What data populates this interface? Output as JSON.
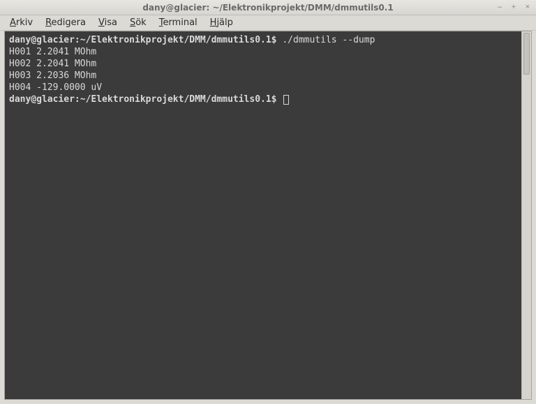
{
  "window": {
    "title": "dany@glacier: ~/Elektronikprojekt/DMM/dmmutils0.1"
  },
  "controls": {
    "minimize": "–",
    "maximize": "+",
    "close": "×"
  },
  "menu": {
    "arkiv": {
      "pre": "",
      "u": "A",
      "post": "rkiv"
    },
    "redigera": {
      "pre": "",
      "u": "R",
      "post": "edigera"
    },
    "visa": {
      "pre": "",
      "u": "V",
      "post": "isa"
    },
    "sok": {
      "pre": "",
      "u": "S",
      "post": "ök"
    },
    "terminal": {
      "pre": "",
      "u": "T",
      "post": "erminal"
    },
    "hjalp": {
      "pre": "",
      "u": "H",
      "post": "jälp"
    }
  },
  "terminal": {
    "prompt": "dany@glacier:~/Elektronikprojekt/DMM/dmmutils0.1$",
    "command": " ./dmmutils --dump",
    "lines": {
      "l1": "H001 2.2041 MOhm",
      "l2": "H002 2.2041 MOhm",
      "l3": "H003 2.2036 MOhm",
      "l4": "H004 -129.0000 uV"
    }
  }
}
